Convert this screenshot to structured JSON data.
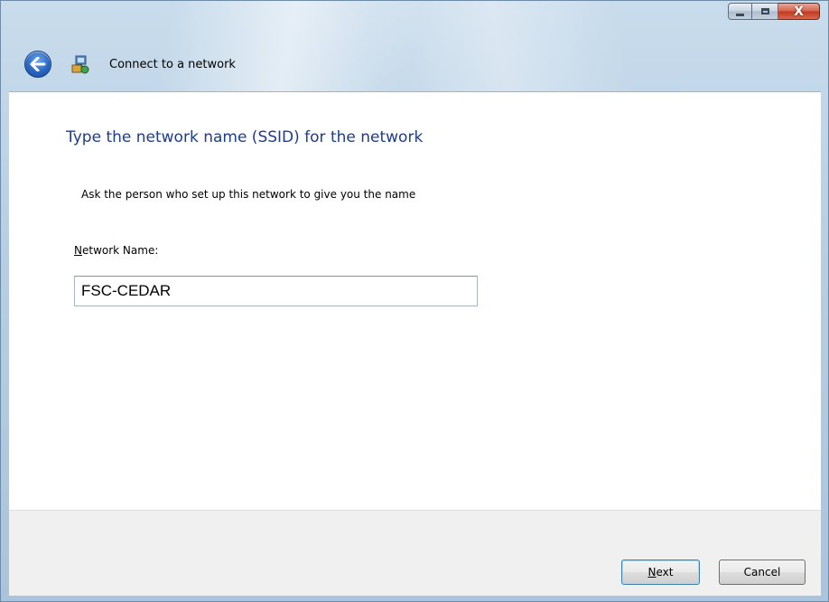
{
  "window": {
    "title": "Connect to a network",
    "controls": {
      "minimize_icon": "minimize-icon",
      "maximize_icon": "maximize-icon",
      "close_glyph": "X"
    }
  },
  "nav": {
    "back_icon": "back-arrow-icon",
    "app_icon": "network-connect-icon"
  },
  "main": {
    "heading": "Type the network name (SSID) for the network",
    "instruction": "Ask the person who set up this network to give you the name",
    "network_name": {
      "label_mnemonic": "N",
      "label_rest": "etwork Name:",
      "value": "FSC-CEDAR",
      "placeholder": ""
    }
  },
  "footer": {
    "next": {
      "mnemonic": "N",
      "rest": "ext"
    },
    "cancel_label": "Cancel"
  },
  "colors": {
    "heading": "#1e3c8c",
    "frame": "#b7cfe4",
    "footer_bg": "#f0f0f0"
  }
}
